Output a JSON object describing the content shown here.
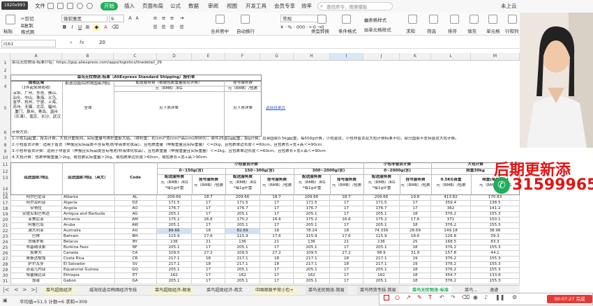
{
  "window": {
    "resolution_badge": "1920x993"
  },
  "menu": {
    "items": [
      "文件",
      "开始",
      "插入",
      "页面布局",
      "公式",
      "数据",
      "审阅",
      "视图",
      "开发工具",
      "会员专享",
      "效率"
    ],
    "active": "开始",
    "search_placeholder": "查找命令、搜索模板",
    "cloud": "未上云"
  },
  "ribbon": {
    "paste": "粘贴",
    "cut": "剪切",
    "copy": "复制",
    "format_painter": "格式刷",
    "font_name": "微软雅黑",
    "font_size": "9",
    "merge": "合并居中",
    "wrap": "自动换行",
    "number_format": "常规",
    "type_convert": "类型转换",
    "conditional": "条件格式",
    "table_style": "表格样式",
    "cell_style": "单元格样式",
    "sum": "求和",
    "filter": "筛选",
    "sort": "排序",
    "fill": "填充",
    "cell": "单元格",
    "rowcol": "行和列",
    "sheet": "工作"
  },
  "formula_bar": {
    "name_box": "I161",
    "fx": "fx",
    "value": "20"
  },
  "columns": [
    "A",
    "B",
    "C",
    "D",
    "E",
    "F",
    "G",
    "H",
    "I",
    "J",
    "K",
    "L",
    "M"
  ],
  "sheet": {
    "row1": "菜鸟无忧物流-标准介绍：https://gsp.aliexpress.com/apps/logistics/linedetail_29",
    "title": "菜鸟无忧物流-标准（AliExpress Standard Shipping）报价单",
    "hdr_region": "配送范围/目的地国家/地区",
    "hdr_service_rate": "配送服务费（根据包裹重量按克计费）",
    "hdr_register_fee": "挂号服务费",
    "hdr_unit1": "元（RMB）/KG",
    "hdr_unit2": "元（RMB）/包裹",
    "origin_label": "揽收区域",
    "origin_sub": "（1件起免费揽收）",
    "origin_cities": "深圳、广州、东莞、佛山、汕头、中山、珠海、义乌、金华、杭州、宁波、上海、苏州、无锡、北京、福州、厦门、泉州、青岛、温州（乐清）、南京、长沙、武汉",
    "global": "全球",
    "see_detail1": "见下表详单",
    "see_detail2": "见下表详单",
    "back_link": "返回目录页",
    "rules_title": "计费方式:",
    "rule1": "1.小包1g起重，按克计费，大包计重规则，实际重量与体积重取大值。（体积重：长(cm)*宽(cm)*高(cm)/8000）；收件25国1g起重，按g计费；其余国家0.5kg起重，每500g计费，小包普货，小包非普货及大包计费标准不同，部分国家不支持普货大包计费。",
    "rule2": "2.小包普货计费：适用于普货（申报且实际品类不含有电池/非液体化妆品）。且包裹重量（申报重量且实际重量）＜=2kg，且包裹单边长度＜=60cm，且包裹长+宽+高＜=90cm",
    "rule3": "3.小包非普货计费：适用于非普货（申报且实际品类含有电池/非液体化妆品），且包裹重量（申报重量且实际重量）＜=2kg，且包裹单边长度＜=60cm，且包裹长+宽+高＜=90cm",
    "rule4": "4.大包计费：包裹申报重量＞2kg，或包裹实际重量＞2kg，或包裹单边长度＞60cm，或包裹长+宽+高＞90cm",
    "grp_small_general": "小包普货计费",
    "grp_small_special": "小包非普货计费",
    "grp_large": "大包计费",
    "w1": "0~150g(含)",
    "w2": "150~300g(含)",
    "w3": "300~2000g(含)",
    "w4": "0~2000g(含)",
    "w5": "限重30kg",
    "col_cn": "运送国家/地区",
    "col_en": "运送国家/地区（英文）",
    "col_code": "Code",
    "sub_rate": "配送服务费",
    "sub_rate_unit": "元（RMB）/KG",
    "sub_rate_note": "*每1g计重",
    "sub_reg": "挂号服务费",
    "sub_reg_unit": "元（RMB）/包裹",
    "sub_first": "0.5KG首重",
    "sub_first_unit": "元（RMB）/包裹",
    "sub_cont": "续重(每500g)",
    "sub_cont_unit": "元（RMB）/500G",
    "rows": [
      {
        "n": "16",
        "cn": "阿尔巴尼亚",
        "en": "Albania",
        "code": "AL",
        "v": [
          "209.66",
          "18.7",
          "209.66",
          "18.7",
          "209.66",
          "18.7",
          "209.66",
          "19.8",
          "413.82",
          "170.83"
        ]
      },
      {
        "n": "17",
        "cn": "阿尔及利亚",
        "en": "Algeria",
        "code": "DZ",
        "v": [
          "171.5",
          "17",
          "171.5",
          "17",
          "171.5",
          "17",
          "171.5",
          "17",
          "359.4",
          "138.5"
        ]
      },
      {
        "n": "18",
        "cn": "安哥拉",
        "en": "Angola",
        "code": "AO",
        "v": [
          "176.7",
          "17",
          "176.7",
          "17",
          "176.7",
          "17",
          "176.7",
          "17",
          "362",
          "141.2"
        ]
      },
      {
        "n": "19",
        "cn": "安提瓜和巴布达",
        "en": "Antigua and Barbuda",
        "code": "AG",
        "v": [
          "205.1",
          "17",
          "205.1",
          "17",
          "205.1",
          "17",
          "205.1",
          "18",
          "376.2",
          "155.3"
        ]
      },
      {
        "n": "20",
        "cn": "亚美尼亚",
        "en": "Armenia",
        "code": "AM",
        "v": [
          "175.2",
          "16.6",
          "175.2",
          "16.6",
          "175.2",
          "16.6",
          "175.2",
          "17.6",
          "371",
          "150.1"
        ]
      },
      {
        "n": "21",
        "cn": "阿鲁巴岛",
        "en": "Aruba",
        "code": "AW",
        "v": [
          "205.1",
          "17",
          "205.1",
          "17",
          "205.1",
          "17",
          "205.1",
          "18",
          "376.2",
          "155.3"
        ]
      },
      {
        "n": "22",
        "cn": "澳大利亚",
        "en": "Australia",
        "code": "AU",
        "v": [
          "89.66",
          "18",
          "82.69",
          "18",
          "78.24",
          "18",
          "74.336",
          "28.69",
          "149.18",
          "38.96"
        ]
      },
      {
        "n": "23",
        "cn": "巴林",
        "en": "Bahrain",
        "code": "BH",
        "v": [
          "115.9",
          "17.6",
          "115.9",
          "17.6",
          "115.9",
          "17.6",
          "115.9",
          "18.6",
          "126.8",
          "39.3"
        ]
      },
      {
        "n": "24",
        "cn": "白俄罗斯",
        "en": "Belarus",
        "code": "BY",
        "v": [
          "136",
          "21",
          "136",
          "21",
          "136",
          "21",
          "136",
          "25",
          "168.5",
          "83.3"
        ]
      },
      {
        "n": "25",
        "cn": "布基纳法索",
        "en": "Burkina Faso",
        "code": "BF",
        "v": [
          "205.1",
          "17",
          "205.1",
          "17",
          "205.1",
          "17",
          "205.1",
          "18",
          "376.2",
          "155.3"
        ]
      },
      {
        "n": "26",
        "cn": "加拿大",
        "en": "Canada",
        "code": "CA",
        "v": [
          "109.5",
          "27.2",
          "109.5",
          "27.2",
          "109.5",
          "27.2",
          "98.9",
          "31.9",
          "157.8",
          "44.1"
        ]
      },
      {
        "n": "27",
        "cn": "哥斯达黎加",
        "en": "Costa Rica",
        "code": "CR",
        "v": [
          "217.1",
          "18",
          "217.1",
          "18",
          "217.1",
          "18",
          "217.1",
          "19",
          "376.2",
          "155.3"
        ]
      },
      {
        "n": "28",
        "cn": "萨尔瓦多",
        "en": "El Salvador",
        "code": "SV",
        "v": [
          "217.1",
          "18",
          "217.1",
          "18",
          "217.1",
          "18",
          "217.1",
          "19",
          "376.2",
          "155.3"
        ]
      },
      {
        "n": "29",
        "cn": "赤道几内亚",
        "en": "Equatorial Guinea",
        "code": "GQ",
        "v": [
          "205.1",
          "17",
          "205.1",
          "17",
          "205.1",
          "17",
          "205.1",
          "18",
          "376.2",
          "155.3"
        ]
      },
      {
        "n": "30",
        "cn": "埃塞俄比亚",
        "en": "Ethiopia",
        "code": "ET",
        "v": [
          "162",
          "17",
          "162",
          "17",
          "162",
          "17",
          "162",
          "18",
          "354.7",
          "133.8"
        ]
      },
      {
        "n": "31",
        "cn": "加蓬",
        "en": "Gabon",
        "code": "GA",
        "v": [
          "205.1",
          "17",
          "205.1",
          "17",
          "205.1",
          "17",
          "205.1",
          "18",
          "376.2",
          "155.3"
        ]
      }
    ],
    "highlighted_row": "22"
  },
  "row_numbers": [
    "1",
    "2",
    "3",
    "4",
    "5",
    "6",
    "7",
    "8",
    "9",
    "10",
    "11",
    "12",
    "13",
    "14",
    "15"
  ],
  "tabs": [
    "菜鸟超级经济",
    "威海优选合韩国经济专线",
    "菜鸟超级经济-顺发",
    "菜鸟超级经济-燕文",
    "中国邮政平常小包+",
    "菜鸟无忧物流-简易",
    "菜鸟特货专线-简易",
    "菜鸟无忧物流-标准",
    "菜鸟...",
    "速递"
  ],
  "active_tab": "菜鸟无忧物流-标准",
  "status": {
    "stats": "平均值=51.5  计数=6  求和=309"
  },
  "overlay": {
    "line1": "后期更新添",
    "line2": "31599965"
  },
  "recorder": {
    "time": "00:07:27",
    "done": "完成"
  },
  "colors": {
    "accent": "#1fae5a",
    "highlight_cell": "#cfe2f5",
    "overlay_red": "#e01515",
    "link_blue": "#2255cc"
  }
}
